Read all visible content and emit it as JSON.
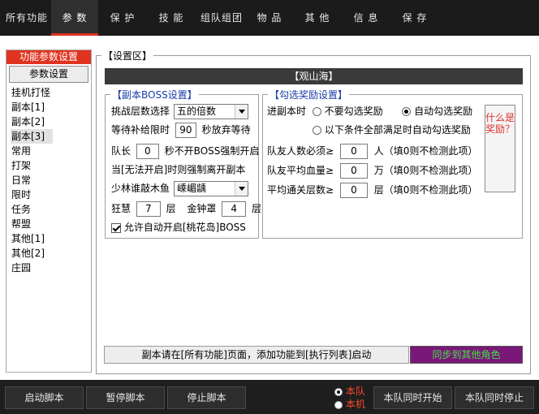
{
  "tabs": [
    "所有功能",
    "参 数",
    "保 护",
    "技 能",
    "组队组团",
    "物 品",
    "其 他",
    "信 息",
    "保 存"
  ],
  "active_tab": 1,
  "leftnav": {
    "header": "功能参数设置",
    "button": "参数设置",
    "items": [
      "挂机打怪",
      "副本[1]",
      "副本[2]",
      "副本[3]",
      "常用",
      "打架",
      "日常",
      "限时",
      "任务",
      "帮盟",
      "其他[1]",
      "其他[2]",
      "庄园"
    ],
    "selected_index": 3
  },
  "settings": {
    "legend": "【设置区】",
    "banner": "【观山海】",
    "boss": {
      "legend": "【副本BOSS设置】",
      "challenge_label": "挑战层数选择",
      "challenge_value": "五的倍数",
      "wait_label": "等待补给限时",
      "wait_value": "90",
      "wait_suffix": "秒放弃等待",
      "captain_prefix": "队长",
      "captain_value": "0",
      "captain_suffix": "秒不开BOSS强制开启",
      "force_leave": "当[无法开启]时则强制离开副本",
      "shaolin_label": "少林谁敲木鱼",
      "shaolin_value": "嵊嵋龋",
      "kuanghui_label": "狂慧",
      "kuanghui_value": "7",
      "ceng1": "层",
      "jinzhong_label": "金钟罩",
      "jinzhong_value": "4",
      "ceng2": "层",
      "allow_label": "允许自动开启[桃花岛]BOSS",
      "allow_checked": true
    },
    "reward": {
      "legend": "【勾选奖励设置】",
      "enter_label": "进副本时",
      "opt_none": "不要勾选奖励",
      "opt_auto": "自动勾选奖励",
      "opt_cond": "以下条件全部满足时自动勾选奖励",
      "selected": "auto",
      "members_label": "队友人数必须≥",
      "members_value": "0",
      "members_unit": "人（填0则不检测此项）",
      "hp_label": "队友平均血量≥",
      "hp_value": "0",
      "hp_unit": "万（填0则不检测此项）",
      "pass_label": "平均通关层数≥",
      "pass_value": "0",
      "pass_unit": "层（填0则不检测此项）",
      "ask_button": "什么是奖励？"
    },
    "tip": "副本请在[所有功能]页面，添加功能到[执行列表]启动",
    "sync_button": "同步到其他角色"
  },
  "bottom": {
    "start": "启动脚本",
    "pause": "暂停脚本",
    "stop": "停止脚本",
    "opt_team": "本队",
    "opt_self": "本机",
    "opt_selected": "team",
    "team_start": "本队同时开始",
    "team_stop": "本队同时停止"
  },
  "colors": {
    "accent_red": "#e03420",
    "dark_bar": "#1b1b1b",
    "sync_bg": "#7a187a",
    "sync_text": "#40e040",
    "legend_blue": "#1a3aa8"
  }
}
